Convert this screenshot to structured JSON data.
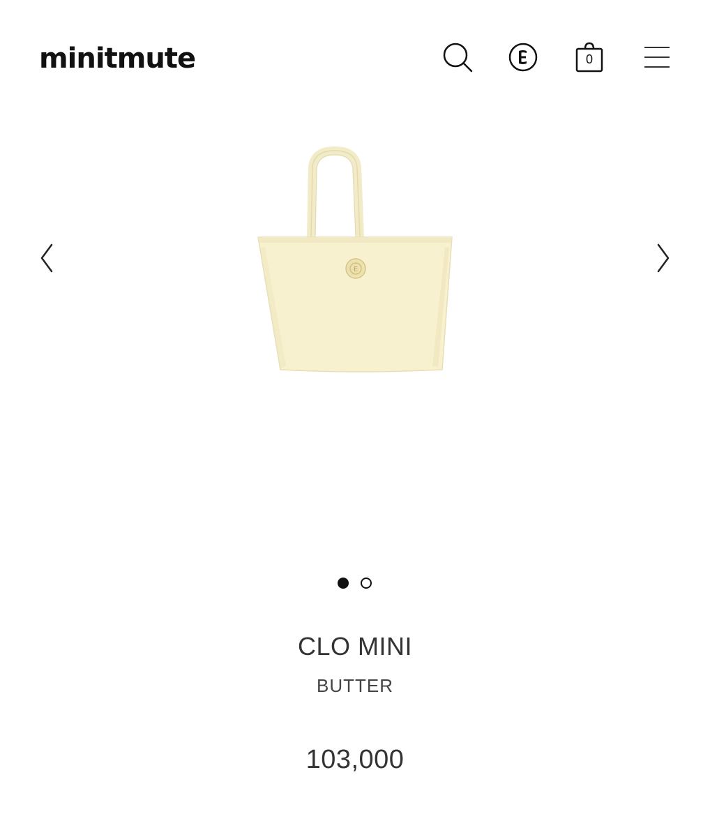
{
  "header": {
    "logo": "minitmute",
    "cart_count": "0"
  },
  "icons": {
    "search": "search-icon",
    "brand": "e-logo-icon",
    "cart": "shopping-bag-icon",
    "menu": "hamburger-menu-icon",
    "prev": "chevron-left-icon",
    "next": "chevron-right-icon"
  },
  "gallery": {
    "slide_count": 2,
    "active_index": 0
  },
  "product": {
    "name": "CLO MINI",
    "color": "BUTTER",
    "price": "103,000"
  },
  "colors": {
    "bag_body": "#f7f1cf",
    "bag_shadow": "#efe7bf",
    "button": "#ede1ae",
    "text_dark": "#111111"
  }
}
